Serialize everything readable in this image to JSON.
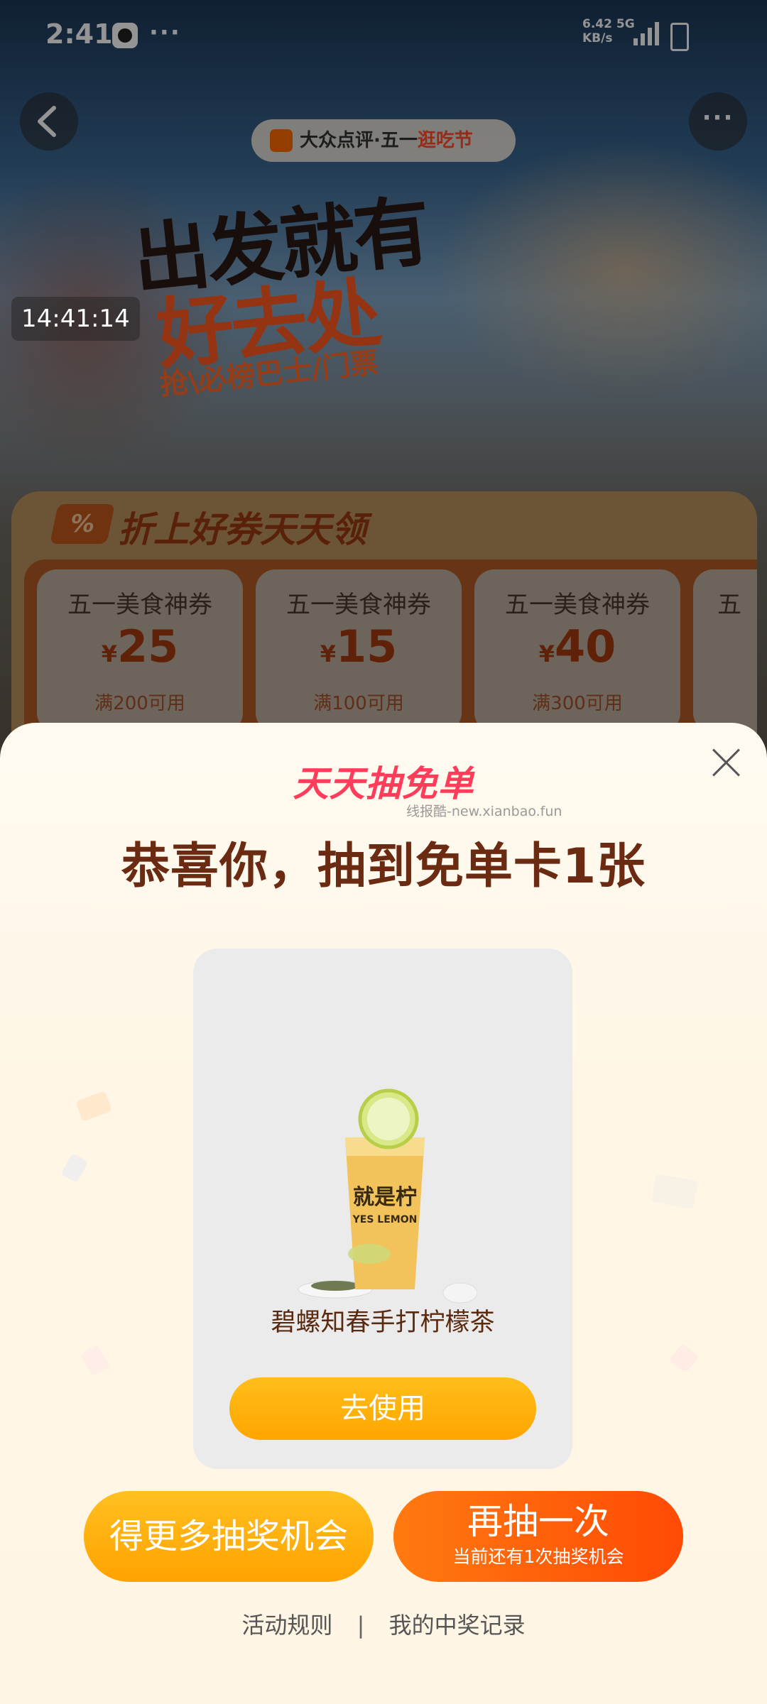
{
  "statusbar": {
    "time": "2:41",
    "more": "···",
    "speed_value": "6.42",
    "speed_unit": "KB/s",
    "network": "5G"
  },
  "header": {
    "brand": "大众点评·五一",
    "brand_tail": "逛吃节",
    "more_label": "···"
  },
  "hero": {
    "line1": "出发就有",
    "line2": "好去处",
    "subtitle": "抢\\必榜巴士/门票"
  },
  "overlay_timestamp": "14:41:14",
  "coupons": {
    "title": "折上好券天天领",
    "icon_label": "%",
    "currency": "¥",
    "items": [
      {
        "name": "五一美食神券",
        "amount": "25",
        "condition": "满200可用"
      },
      {
        "name": "五一美食神券",
        "amount": "15",
        "condition": "满100可用"
      },
      {
        "name": "五一美食神券",
        "amount": "40",
        "condition": "满300可用"
      },
      {
        "name": "五"
      }
    ]
  },
  "modal": {
    "logo": "天天抽免单",
    "watermark": "线报酷-new.xianbao.fun",
    "title": "恭喜你，抽到免单卡1张",
    "prize": {
      "brand_cn": "就是柠",
      "brand_en": "YES LEMON",
      "name": "碧螺知春手打柠檬茶",
      "use_button": "去使用"
    },
    "more_chances_button": "得更多抽奖机会",
    "draw_again": {
      "label": "再抽一次",
      "sublabel": "当前还有1次抽奖机会"
    },
    "footer": {
      "rules": "活动规则",
      "separator": "|",
      "records": "我的中奖记录"
    }
  },
  "colors": {
    "modal_title": "#6b2a12",
    "logo": "#ff3d5a",
    "use_button": "#ffa500",
    "draw_again": "#ff4a05"
  }
}
